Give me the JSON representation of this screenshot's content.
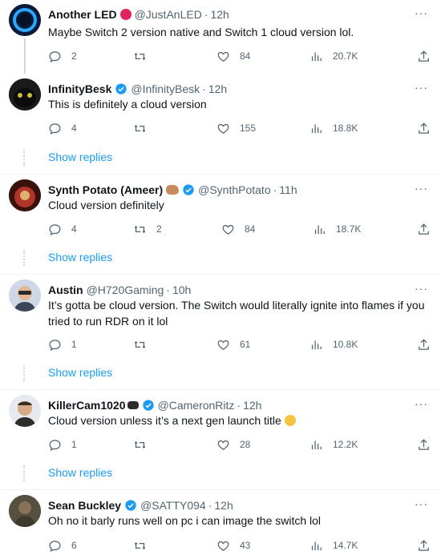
{
  "replies": [
    {
      "name": "Another LED",
      "handle": "@JustAnLED",
      "time": "12h",
      "text": "Maybe Switch 2 version native and Switch 1 cloud version lol.",
      "stats": {
        "replies": "2",
        "retweets": "",
        "likes": "84",
        "views": "20.7K"
      },
      "show_replies": ""
    },
    {
      "name": "InfinityBesk",
      "handle": "@InfinityBesk",
      "time": "12h",
      "text": "This is definitely a cloud version",
      "stats": {
        "replies": "4",
        "retweets": "",
        "likes": "155",
        "views": "18.8K"
      },
      "show_replies": "Show replies"
    },
    {
      "name": "Synth Potato (Ameer)",
      "handle": "@SynthPotato",
      "time": "11h",
      "text": "Cloud version definitely",
      "stats": {
        "replies": "4",
        "retweets": "2",
        "likes": "84",
        "views": "18.7K"
      },
      "show_replies": "Show replies"
    },
    {
      "name": "Austin",
      "handle": "@H720Gaming",
      "time": "10h",
      "text": "It’s gotta be cloud version. The Switch would literally ignite into flames if you tried to run RDR on it lol",
      "stats": {
        "replies": "1",
        "retweets": "",
        "likes": "61",
        "views": "10.8K"
      },
      "show_replies": "Show replies"
    },
    {
      "name": "KillerCam1020",
      "handle": "@CameronRitz",
      "time": "12h",
      "text": "Cloud version unless it’s a next gen launch title",
      "stats": {
        "replies": "1",
        "retweets": "",
        "likes": "28",
        "views": "12.2K"
      },
      "show_replies": "Show replies"
    },
    {
      "name": "Sean Buckley",
      "handle": "@SATTY094",
      "time": "12h",
      "text": "Oh no it barly runs well on pc i can image the switch lol",
      "stats": {
        "replies": "6",
        "retweets": "",
        "likes": "43",
        "views": "14.7K"
      },
      "show_replies": ""
    }
  ],
  "dot": "·",
  "more": "···",
  "colors": {
    "accent": "#1d9bf0",
    "muted": "#536471",
    "text": "#0f1419"
  }
}
